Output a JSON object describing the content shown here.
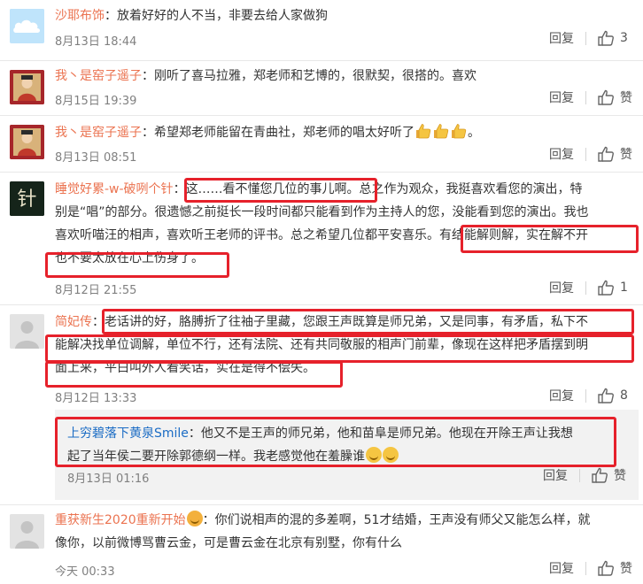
{
  "actions": {
    "reply_label": "回复",
    "like_label": "赞"
  },
  "comments": [
    {
      "user": "沙耶布饰",
      "sep": "：",
      "text": "放着好好的人不当，非要去给人家做狗",
      "time": "8月13日 18:44",
      "likes": "3"
    },
    {
      "user": "我丶是窑子遥子",
      "sep": "：",
      "text": "刚听了喜马拉雅，郑老师和艺博的，很默契，很搭的。喜欢",
      "time": "8月15日 19:39",
      "likes": ""
    },
    {
      "user": "我丶是窑子遥子",
      "sep": "：",
      "text": "希望郑老师能留在青曲社，郑老师的唱太好听了",
      "text_end": "。",
      "time": "8月13日 08:51",
      "likes": ""
    },
    {
      "user": "睡觉好累-w-破咧个针",
      "sep": "：",
      "line1": "这……看不懂您几位的事儿啊。总之作为观众，我挺喜欢看您的演出，特",
      "line2": "别是“唱”的部分。很遗憾之前挺长一段时间都只能看到作为主持人的您，没能看到您的演出。我也",
      "line3": "喜欢听喵汪的相声，喜欢听王老师的评书。总之希望几位都平安喜乐。有结能解则解，实在解不开",
      "line4": "也不要太放在心上伤身了。",
      "time": "8月12日 21:55",
      "likes": "1"
    },
    {
      "user": "简妃传",
      "sep": "：",
      "line1": "老话讲的好，胳膊折了往袖子里藏，您跟王声既算是师兄弟，又是同事，有矛盾，私下不",
      "line2": "能解决找单位调解，单位不行，还有法院、还有共同敬服的相声门前辈，像现在这样把矛盾摆到明",
      "line3": "面上来，平白叫外人看笑话，实在是得不偿失。",
      "time": "8月12日 13:33",
      "likes": "8",
      "reply": {
        "user": "上穷碧落下黄泉Smile",
        "sep": "：",
        "line1": "他又不是王声的师兄弟，他和苗阜是师兄弟。他现在开除王声让我想",
        "line2": "起了当年侯二要开除郭德纲一样。我老感觉他在羞臊谁",
        "time": "8月13日 01:16"
      }
    },
    {
      "user": "重获新生2020重新开始",
      "sep": "：",
      "line1": "你们说相声的混的多差啊，51才结婚，王声没有师父又能怎么样，就",
      "line2": "像你，以前微博骂曹云金，可是曹云金在北京有别墅，你有什么",
      "time": "今天 00:33",
      "likes": ""
    }
  ],
  "avatar_glyph": "针",
  "colors": {
    "username": "#eb7350",
    "reply_username": "#1b6cc4",
    "highlight_box": "#e6212b",
    "reply_bg": "#f2f2f2"
  }
}
